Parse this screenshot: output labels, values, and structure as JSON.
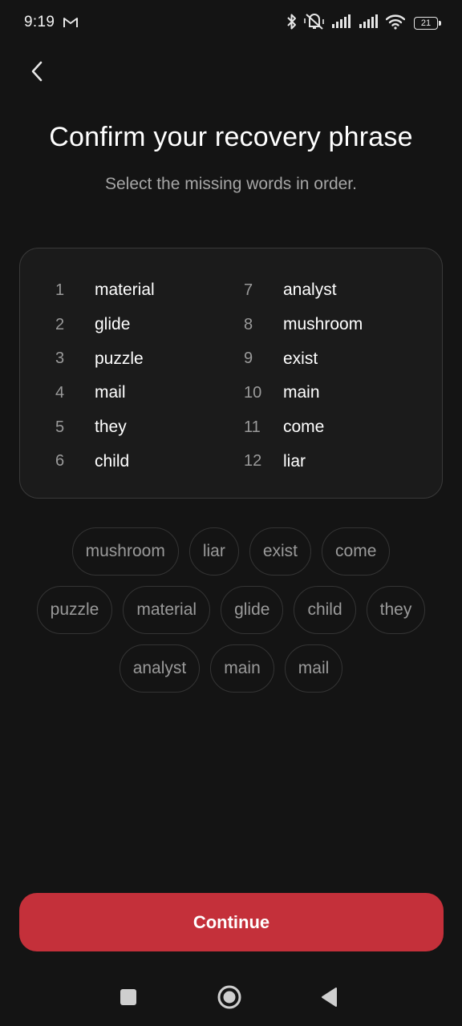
{
  "status_bar": {
    "time": "9:19",
    "battery": "21",
    "icons": [
      "gmail-icon",
      "bluetooth-icon",
      "vibrate-off-icon",
      "signal-icon",
      "signal-icon",
      "wifi-icon",
      "battery-icon"
    ]
  },
  "header": {
    "back_icon": "chevron-left-icon",
    "title": "Confirm your recovery phrase",
    "subtitle": "Select the missing words in order."
  },
  "phrase": {
    "left": [
      {
        "num": "1",
        "word": "material"
      },
      {
        "num": "2",
        "word": "glide"
      },
      {
        "num": "3",
        "word": "puzzle"
      },
      {
        "num": "4",
        "word": "mail"
      },
      {
        "num": "5",
        "word": "they"
      },
      {
        "num": "6",
        "word": "child"
      }
    ],
    "right": [
      {
        "num": "7",
        "word": "analyst"
      },
      {
        "num": "8",
        "word": "mushroom"
      },
      {
        "num": "9",
        "word": "exist"
      },
      {
        "num": "10",
        "word": "main"
      },
      {
        "num": "11",
        "word": "come"
      },
      {
        "num": "12",
        "word": "liar"
      }
    ]
  },
  "word_choices": [
    [
      "mushroom",
      "liar",
      "exist",
      "come"
    ],
    [
      "puzzle",
      "material",
      "glide",
      "child",
      "they"
    ],
    [
      "analyst",
      "main",
      "mail"
    ]
  ],
  "actions": {
    "continue_label": "Continue"
  },
  "colors": {
    "background": "#141414",
    "accent": "#c4303a",
    "card": "#1b1b1b",
    "muted_text": "#9a9a9a"
  },
  "nav_bar": {
    "icons": [
      "recent-apps-icon",
      "home-icon",
      "back-triangle-icon"
    ]
  }
}
